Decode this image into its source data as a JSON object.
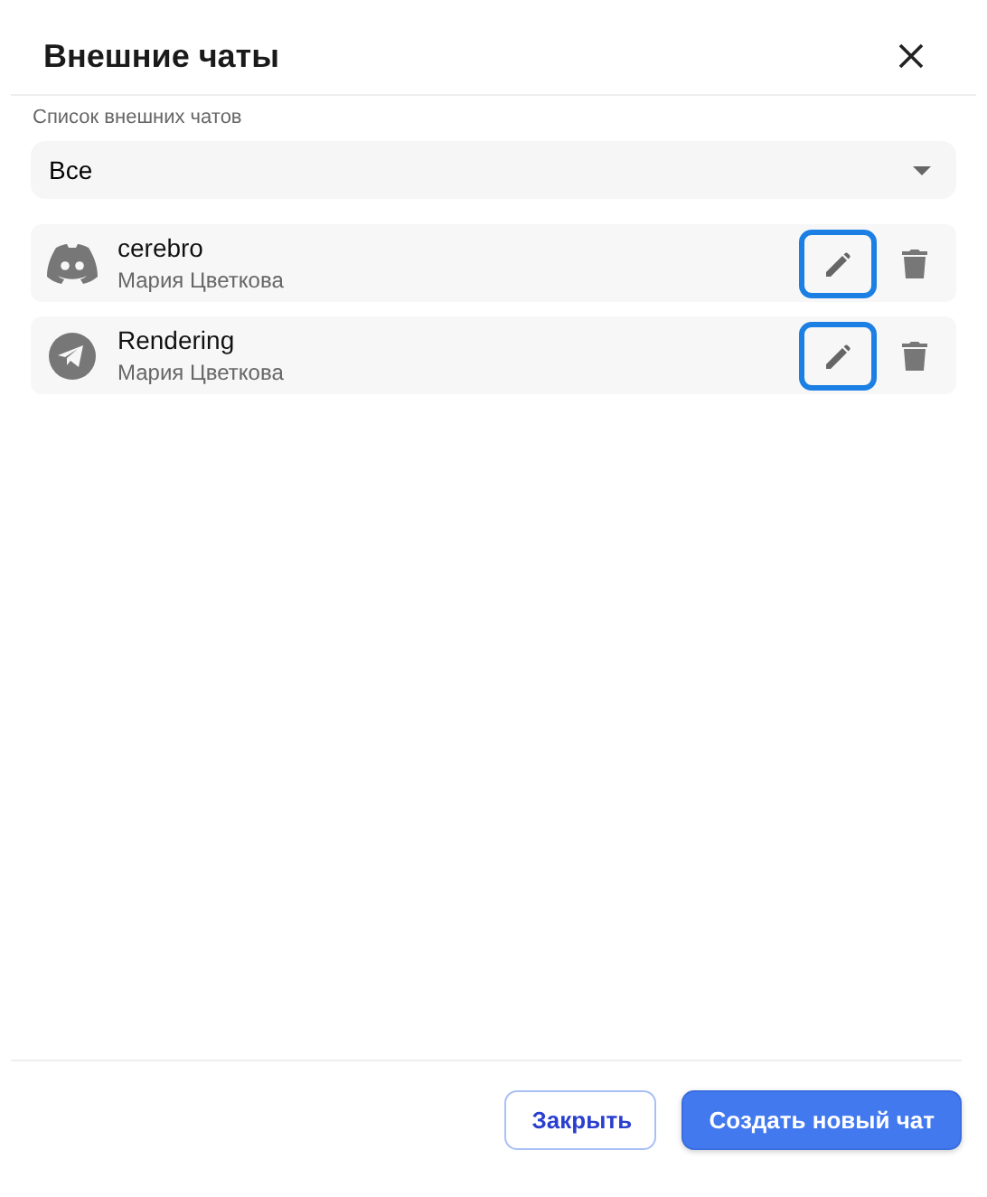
{
  "dialog": {
    "title": "Внешние чаты"
  },
  "filter": {
    "label": "Список внешних чатов",
    "value": "Все"
  },
  "chats": [
    {
      "kind": "discord",
      "name": "cerebro",
      "owner": "Мария Цветкова",
      "edit_highlighted": true
    },
    {
      "kind": "telegram",
      "name": "Rendering",
      "owner": "Мария Цветкова",
      "edit_highlighted": true
    }
  ],
  "buttons": [
    {
      "label": "Закрыть",
      "kind": "secondary"
    },
    {
      "label": "Создать новый чат",
      "kind": "primary"
    }
  ]
}
